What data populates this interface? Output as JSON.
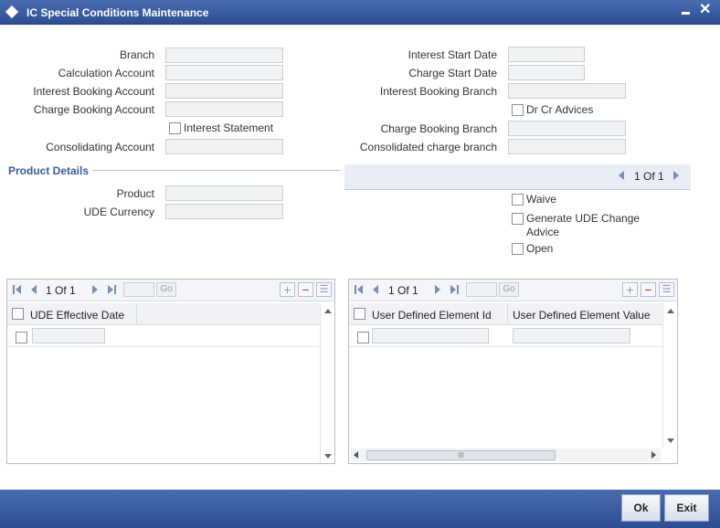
{
  "window": {
    "title": "IC Special Conditions Maintenance"
  },
  "fields": {
    "branch": {
      "label": "Branch",
      "value": ""
    },
    "calculation_account": {
      "label": "Calculation Account",
      "value": ""
    },
    "interest_booking_account": {
      "label": "Interest Booking Account",
      "value": ""
    },
    "charge_booking_account": {
      "label": "Charge Booking Account",
      "value": ""
    },
    "interest_statement": {
      "label": "Interest Statement",
      "checked": false
    },
    "consolidating_account": {
      "label": "Consolidating Account",
      "value": ""
    },
    "interest_start_date": {
      "label": "Interest Start Date",
      "value": ""
    },
    "charge_start_date": {
      "label": "Charge Start Date",
      "value": ""
    },
    "interest_booking_branch": {
      "label": "Interest Booking Branch",
      "value": ""
    },
    "dr_cr_advices": {
      "label": "Dr Cr Advices",
      "checked": false
    },
    "charge_booking_branch": {
      "label": "Charge Booking Branch",
      "value": ""
    },
    "consolidated_charge_branch": {
      "label": "Consolidated charge branch",
      "value": ""
    }
  },
  "product_details": {
    "title": "Product Details",
    "pager": "1 Of 1",
    "product": {
      "label": "Product",
      "value": ""
    },
    "ude_currency": {
      "label": "UDE Currency",
      "value": ""
    },
    "waive": {
      "label": "Waive",
      "checked": false
    },
    "generate_ude_change_advice": {
      "label_line1": "Generate UDE Change",
      "label_line2": "Advice",
      "checked": false
    },
    "open": {
      "label": "Open",
      "checked": false
    }
  },
  "grid_left": {
    "pager": "1 Of 1",
    "go_label": "Go",
    "columns": [
      "UDE Effective Date"
    ]
  },
  "grid_right": {
    "pager": "1 Of 1",
    "go_label": "Go",
    "columns": [
      "User Defined Element Id",
      "User Defined Element Value"
    ],
    "hscroll_grip": "III"
  },
  "buttons": {
    "ok": "Ok",
    "exit": "Exit"
  },
  "icons": {
    "add": "plus-icon",
    "delete": "minus-icon",
    "view": "list-icon"
  },
  "colors": {
    "titlebar": "#2c4d93",
    "section_title": "#3a5a9a"
  }
}
